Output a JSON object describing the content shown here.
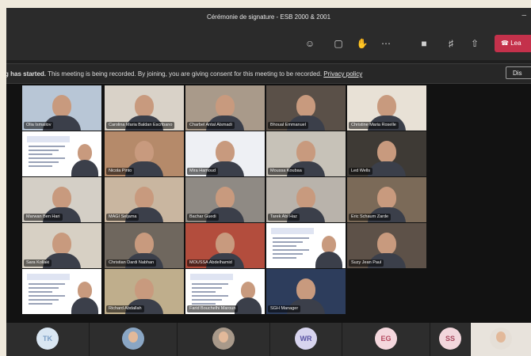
{
  "window": {
    "title": "Cérémonie de signature - ESB 2000 & 2001",
    "controls": "–"
  },
  "toolbar": {
    "leave_label": "Lea"
  },
  "banner": {
    "bold_text": "g has started.",
    "message": " This meeting is being recorded. By joining, you are giving consent for this meeting to be recorded. ",
    "link": "Privacy policy",
    "dismiss_label": "Dis"
  },
  "grid": {
    "tiles": [
      {
        "name": "Olia Ismailov",
        "kind": "person",
        "bg": "#b8c6d6"
      },
      {
        "name": "Carolina Maria Baldan Escribano",
        "kind": "person",
        "bg": "#d9d2c8"
      },
      {
        "name": "Charbel Antal Alsmadi",
        "kind": "person",
        "bg": "#a99a8a"
      },
      {
        "name": "Bhoual Emmanuel",
        "kind": "person",
        "bg": "#5a5048"
      },
      {
        "name": "Christine Maria Roselle",
        "kind": "person",
        "bg": "#e8e1d6"
      },
      {
        "name": "",
        "kind": "slide",
        "bg": "#ffffff"
      },
      {
        "name": "Nicola Pinto",
        "kind": "person",
        "bg": "#b58a6a"
      },
      {
        "name": "Mira Hamoud",
        "kind": "person",
        "bg": "#eef0f4"
      },
      {
        "name": "Moussa Koubaa",
        "kind": "person",
        "bg": "#c7c2b8"
      },
      {
        "name": "Led Wells",
        "kind": "person",
        "bg": "#3e3a35"
      },
      {
        "name": "Marwan Ben Hari",
        "kind": "person",
        "bg": "#d4cfc6"
      },
      {
        "name": "MAGI Seljama",
        "kind": "person",
        "bg": "#c9b6a0"
      },
      {
        "name": "Bachar Guedi",
        "kind": "person",
        "bg": "#8f8a84"
      },
      {
        "name": "Tarek Abi Haz",
        "kind": "person",
        "bg": "#b9b3ab"
      },
      {
        "name": "Eric Schaum Zarde",
        "kind": "person",
        "bg": "#7b6a58"
      },
      {
        "name": "Sara Kollaki",
        "kind": "person",
        "bg": "#d7d0c4"
      },
      {
        "name": "Christian Dardi Nabhan",
        "kind": "person",
        "bg": "#6f675e"
      },
      {
        "name": "MOUSSA Abdelhamid",
        "kind": "person",
        "bg": "#b34d3d"
      },
      {
        "name": "",
        "kind": "slide",
        "bg": "#ffffff"
      },
      {
        "name": "Suzy Jean Paul",
        "kind": "person",
        "bg": "#5d5148"
      },
      {
        "name": "",
        "kind": "slide",
        "bg": "#ffffff"
      },
      {
        "name": "Richard Abdallah",
        "kind": "person",
        "bg": "#bfae8c"
      },
      {
        "name": "Farid Bouchelhi Maroun",
        "kind": "slide",
        "bg": "#ffffff"
      },
      {
        "name": "SGH Manager",
        "kind": "person",
        "bg": "#2d3d5c"
      }
    ]
  },
  "bottom": {
    "participants": [
      {
        "initials": "TK",
        "kind": "initials",
        "color": "#7b9ec4",
        "bg": "#d9e6f2"
      },
      {
        "initials": "",
        "kind": "photo",
        "color": "#000",
        "bg": "#8aa6c4"
      },
      {
        "initials": "",
        "kind": "photo",
        "color": "#000",
        "bg": "#a8998a"
      },
      {
        "initials": "WR",
        "kind": "initials",
        "color": "#5a54a3",
        "bg": "#d7d4ee"
      },
      {
        "initials": "EG",
        "kind": "initials",
        "color": "#b4495f",
        "bg": "#f4d7dd"
      },
      {
        "initials": "SS",
        "kind": "initials",
        "color": "#a8485e",
        "bg": "#f2d6dc"
      },
      {
        "initials": "",
        "kind": "photo",
        "color": "#000",
        "bg": "#e5dfd7"
      }
    ]
  }
}
